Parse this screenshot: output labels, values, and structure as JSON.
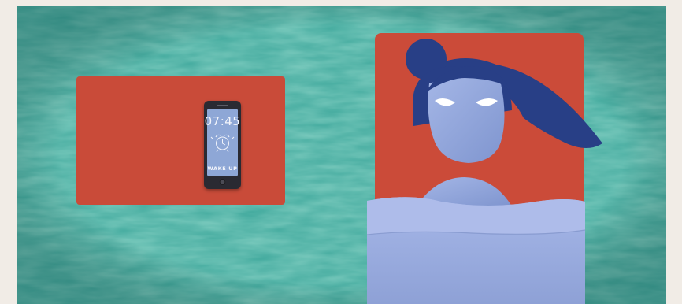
{
  "scene": {
    "colors": {
      "paper": "#f1ece6",
      "teal": "#3fa89c",
      "teal_light": "#6cc3b0",
      "red_panel": "#d6503d",
      "phone_body": "#2a2a30",
      "phone_screen": "#8ea7d6",
      "phone_ink": "#f2f4fb",
      "face": "#8fa4d8",
      "hair": "#283f86",
      "eye": "#ffffff",
      "blanket": "#9aace0",
      "blanket_fold": "#aebcea"
    }
  },
  "phone": {
    "time": "07:45",
    "label": "WAKE UP",
    "icon": "alarm-clock-icon"
  }
}
